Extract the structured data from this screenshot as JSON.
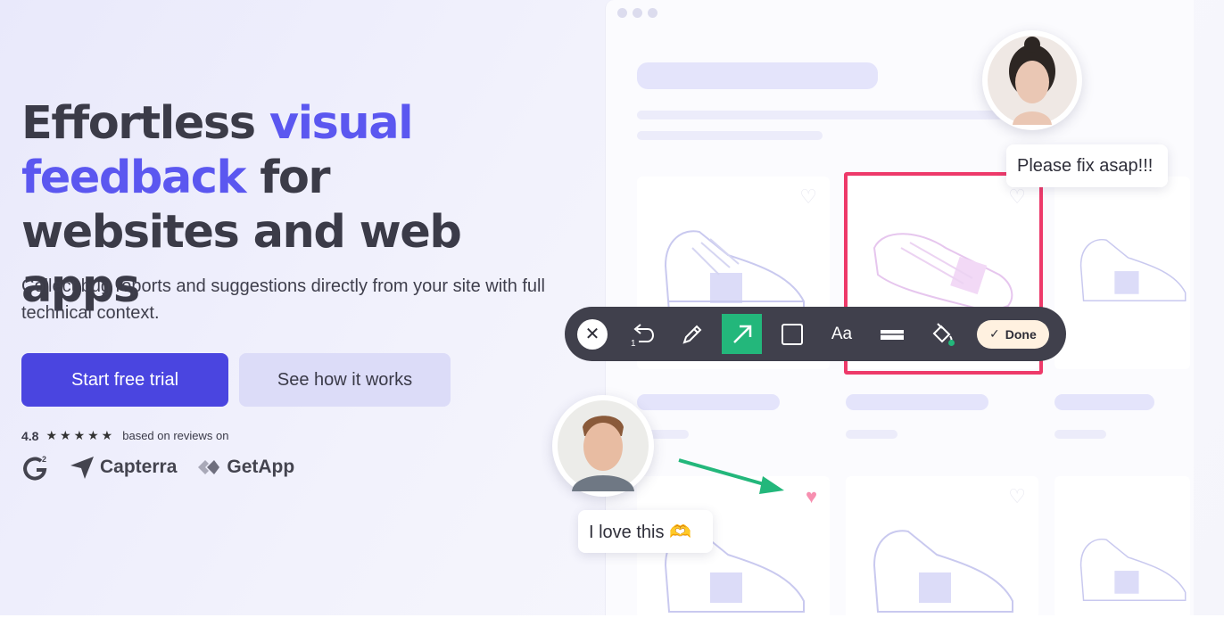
{
  "hero": {
    "title_part1": "Effortless ",
    "title_accent1": "visual",
    "title_accent2": "feedback",
    "title_part2": " for websites and web apps",
    "subtitle": "Collect bug reports and suggestions directly from your site with full technical context.",
    "primary_cta": "Start free trial",
    "secondary_cta": "See how it works"
  },
  "rating": {
    "score": "4.8",
    "stars": 5,
    "stars_text": "★★★★★",
    "based_on": "based on reviews on",
    "platforms": [
      "G2",
      "Capterra",
      "GetApp"
    ]
  },
  "comments": [
    {
      "text": "Please fix asap!!!"
    },
    {
      "text": "I love this 🫶"
    }
  ],
  "toolbar": {
    "undo_count": "1",
    "text_tool": "Aa",
    "done_label": "Done",
    "done_check": "✓",
    "close_glyph": "✕"
  },
  "colors": {
    "accent": "#5b57f0",
    "primary_button": "#4a45e0",
    "highlight": "#ee3a6a",
    "active_tool": "#23b77b",
    "arrow": "#23b77b"
  },
  "icons": [
    "close-icon",
    "undo-icon",
    "pencil-icon",
    "arrow-tool-icon",
    "rectangle-icon",
    "text-icon",
    "strikethrough-icon",
    "paint-bucket-icon",
    "check-icon",
    "heart-icon",
    "star-icon",
    "g2-logo",
    "capterra-logo",
    "getapp-logo"
  ]
}
